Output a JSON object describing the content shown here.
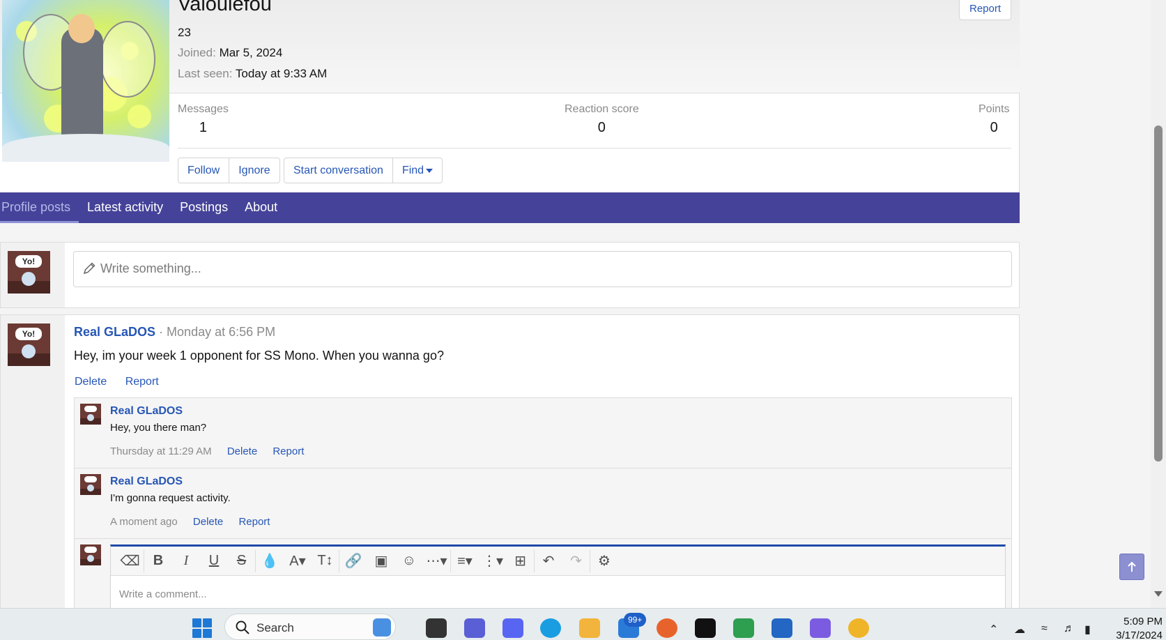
{
  "profile": {
    "username": "Valoulefou",
    "number": "23",
    "joined_label": "Joined:",
    "joined_value": "Mar 5, 2024",
    "last_seen_label": "Last seen:",
    "last_seen_value": "Today at 9:33 AM",
    "report_label": "Report",
    "stats": [
      {
        "label": "Messages",
        "value": "1"
      },
      {
        "label": "Reaction score",
        "value": "0"
      },
      {
        "label": "Points",
        "value": "0"
      }
    ],
    "buttons": {
      "follow": "Follow",
      "ignore": "Ignore",
      "start_conversation": "Start conversation",
      "find": "Find"
    }
  },
  "tabs": [
    {
      "label": "Profile posts",
      "active": true
    },
    {
      "label": "Latest activity"
    },
    {
      "label": "Postings"
    },
    {
      "label": "About"
    }
  ],
  "composer": {
    "placeholder": "Write something...",
    "avatar_text": "Yo!"
  },
  "post": {
    "author": "Real GLaDOS",
    "separator": " · ",
    "time": "Monday at 6:56 PM",
    "body": "Hey, im your week 1 opponent for SS Mono. When you wanna go?",
    "actions": [
      "Delete",
      "Report"
    ],
    "avatar_text": "Yo!"
  },
  "comments": [
    {
      "author": "Real GLaDOS",
      "text": "Hey, you there man?",
      "time": "Thursday at 11:29 AM",
      "actions": [
        "Delete",
        "Report"
      ]
    },
    {
      "author": "Real GLaDOS",
      "text": "I'm gonna request activity.",
      "time": "A moment ago",
      "actions": [
        "Delete",
        "Report"
      ]
    }
  ],
  "editor": {
    "placeholder": "Write a comment...",
    "tools": [
      "eraser-icon",
      "bold-icon",
      "italic-icon",
      "underline-icon",
      "strikethrough-icon",
      "color-icon",
      "font-family-icon",
      "font-size-icon",
      "link-icon",
      "image-icon",
      "emoji-icon",
      "more-icon",
      "align-icon",
      "list-icon",
      "table-icon",
      "undo-icon",
      "redo-icon",
      "settings-icon"
    ]
  },
  "taskbar": {
    "search_label": "Search",
    "mail_badge": "99+",
    "time": "5:09 PM",
    "date": "3/17/2024"
  },
  "colors": {
    "accent": "#454399",
    "link": "#2656b5"
  }
}
